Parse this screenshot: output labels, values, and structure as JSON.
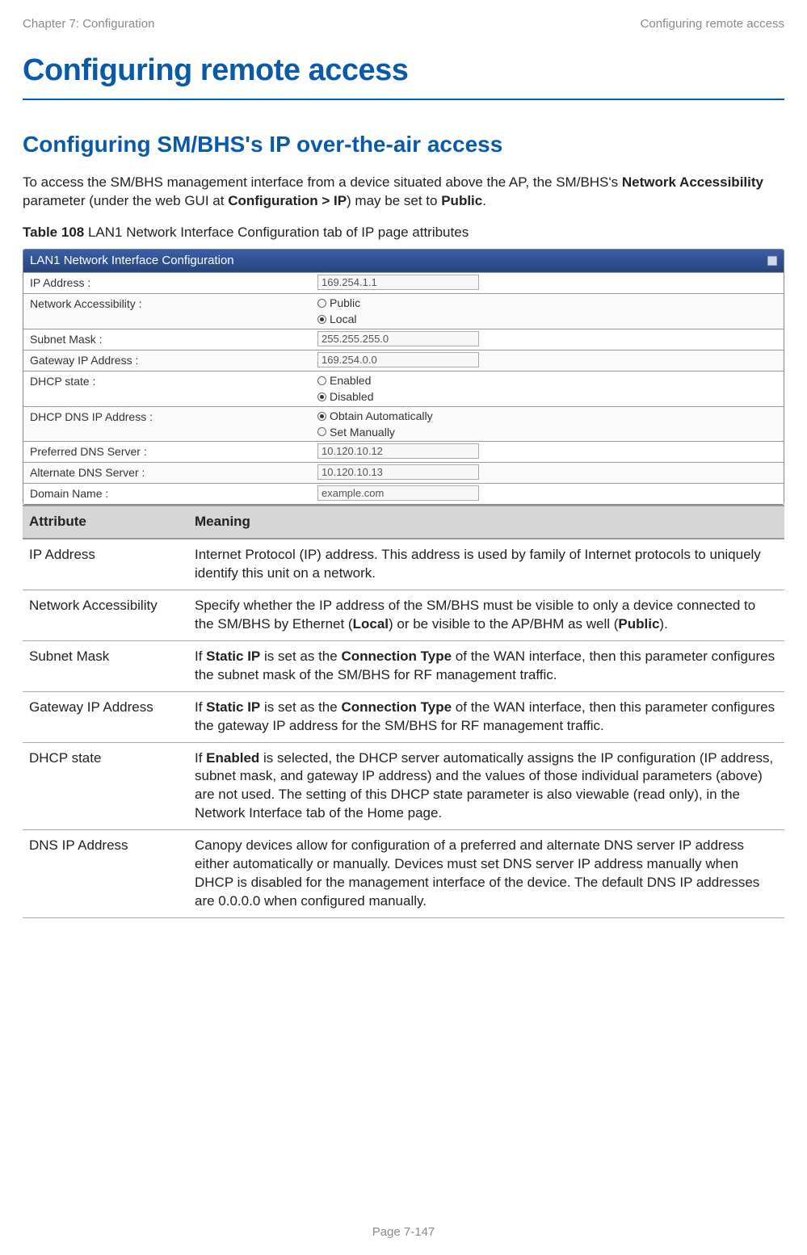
{
  "header": {
    "left": "Chapter 7:  Configuration",
    "right": "Configuring remote access"
  },
  "title": "Configuring remote access",
  "subtitle": "Configuring SM/BHS's IP over-the-air access",
  "intro": {
    "pre": "To access the SM/BHS management interface from a device situated above the AP, the SM/BHS's ",
    "b1": "Network Accessibility",
    "mid1": " parameter (under the web GUI at ",
    "b2": "Configuration > IP",
    "mid2": ") may be set to ",
    "b3": "Public",
    "end": "."
  },
  "table_caption": {
    "b": "Table 108",
    "rest": "  LAN1 Network Interface Configuration tab of IP page attributes"
  },
  "lan": {
    "title": "LAN1 Network Interface Configuration",
    "rows": {
      "ip_label": "IP Address :",
      "ip_val": "169.254.1.1",
      "na_label": "Network Accessibility :",
      "na_public": "Public",
      "na_local": "Local",
      "sm_label": "Subnet Mask :",
      "sm_val": "255.255.255.0",
      "gw_label": "Gateway IP Address :",
      "gw_val": "169.254.0.0",
      "dhcp_label": "DHCP state :",
      "dhcp_enabled": "Enabled",
      "dhcp_disabled": "Disabled",
      "dns_label": "DHCP DNS IP Address :",
      "dns_auto": "Obtain Automatically",
      "dns_manual": "Set Manually",
      "pdns_label": "Preferred DNS Server :",
      "pdns_val": "10.120.10.12",
      "adns_label": "Alternate DNS Server :",
      "adns_val": "10.120.10.13",
      "dom_label": "Domain Name :",
      "dom_val": "example.com"
    }
  },
  "attr_headers": {
    "attr": "Attribute",
    "meaning": "Meaning"
  },
  "attrs": {
    "r1a": "IP Address",
    "r1m": "Internet Protocol (IP) address. This address is used by family of Internet protocols to uniquely identify this unit on a network.",
    "r2a": "Network Accessibility",
    "r2m_pre": "Specify whether the IP address of the SM/BHS must be visible to only a device connected to the SM/BHS by Ethernet (",
    "r2m_b1": "Local",
    "r2m_mid": ") or be visible to the AP/BHM as well (",
    "r2m_b2": "Public",
    "r2m_end": ").",
    "r3a": "Subnet Mask",
    "r3m_pre": "If ",
    "r3m_b1": "Static IP",
    "r3m_mid1": " is set as the ",
    "r3m_b2": "Connection Type",
    "r3m_end": " of the WAN interface, then this parameter configures the subnet mask of the SM/BHS for RF management traffic.",
    "r4a": "Gateway IP Address",
    "r4m_pre": "If ",
    "r4m_b1": "Static IP",
    "r4m_mid1": " is set as the ",
    "r4m_b2": "Connection Type",
    "r4m_end": " of the WAN interface, then this parameter configures the gateway IP address for the SM/BHS for RF management traffic.",
    "r5a": "DHCP state",
    "r5m_pre": "If ",
    "r5m_b1": "Enabled",
    "r5m_end": " is selected, the DHCP server automatically assigns the IP configuration (IP address, subnet mask, and gateway IP address) and the values of those individual parameters (above) are not used. The setting of this DHCP state parameter is also viewable (read only), in the Network Interface tab of the Home page.",
    "r6a": "DNS IP Address",
    "r6m": "Canopy devices allow for configuration of a preferred and alternate DNS server IP address either automatically or manually. Devices must set DNS server IP address manually when DHCP is disabled for the management interface of the device. The default DNS IP addresses are 0.0.0.0 when configured manually."
  },
  "footer": "Page 7-147"
}
